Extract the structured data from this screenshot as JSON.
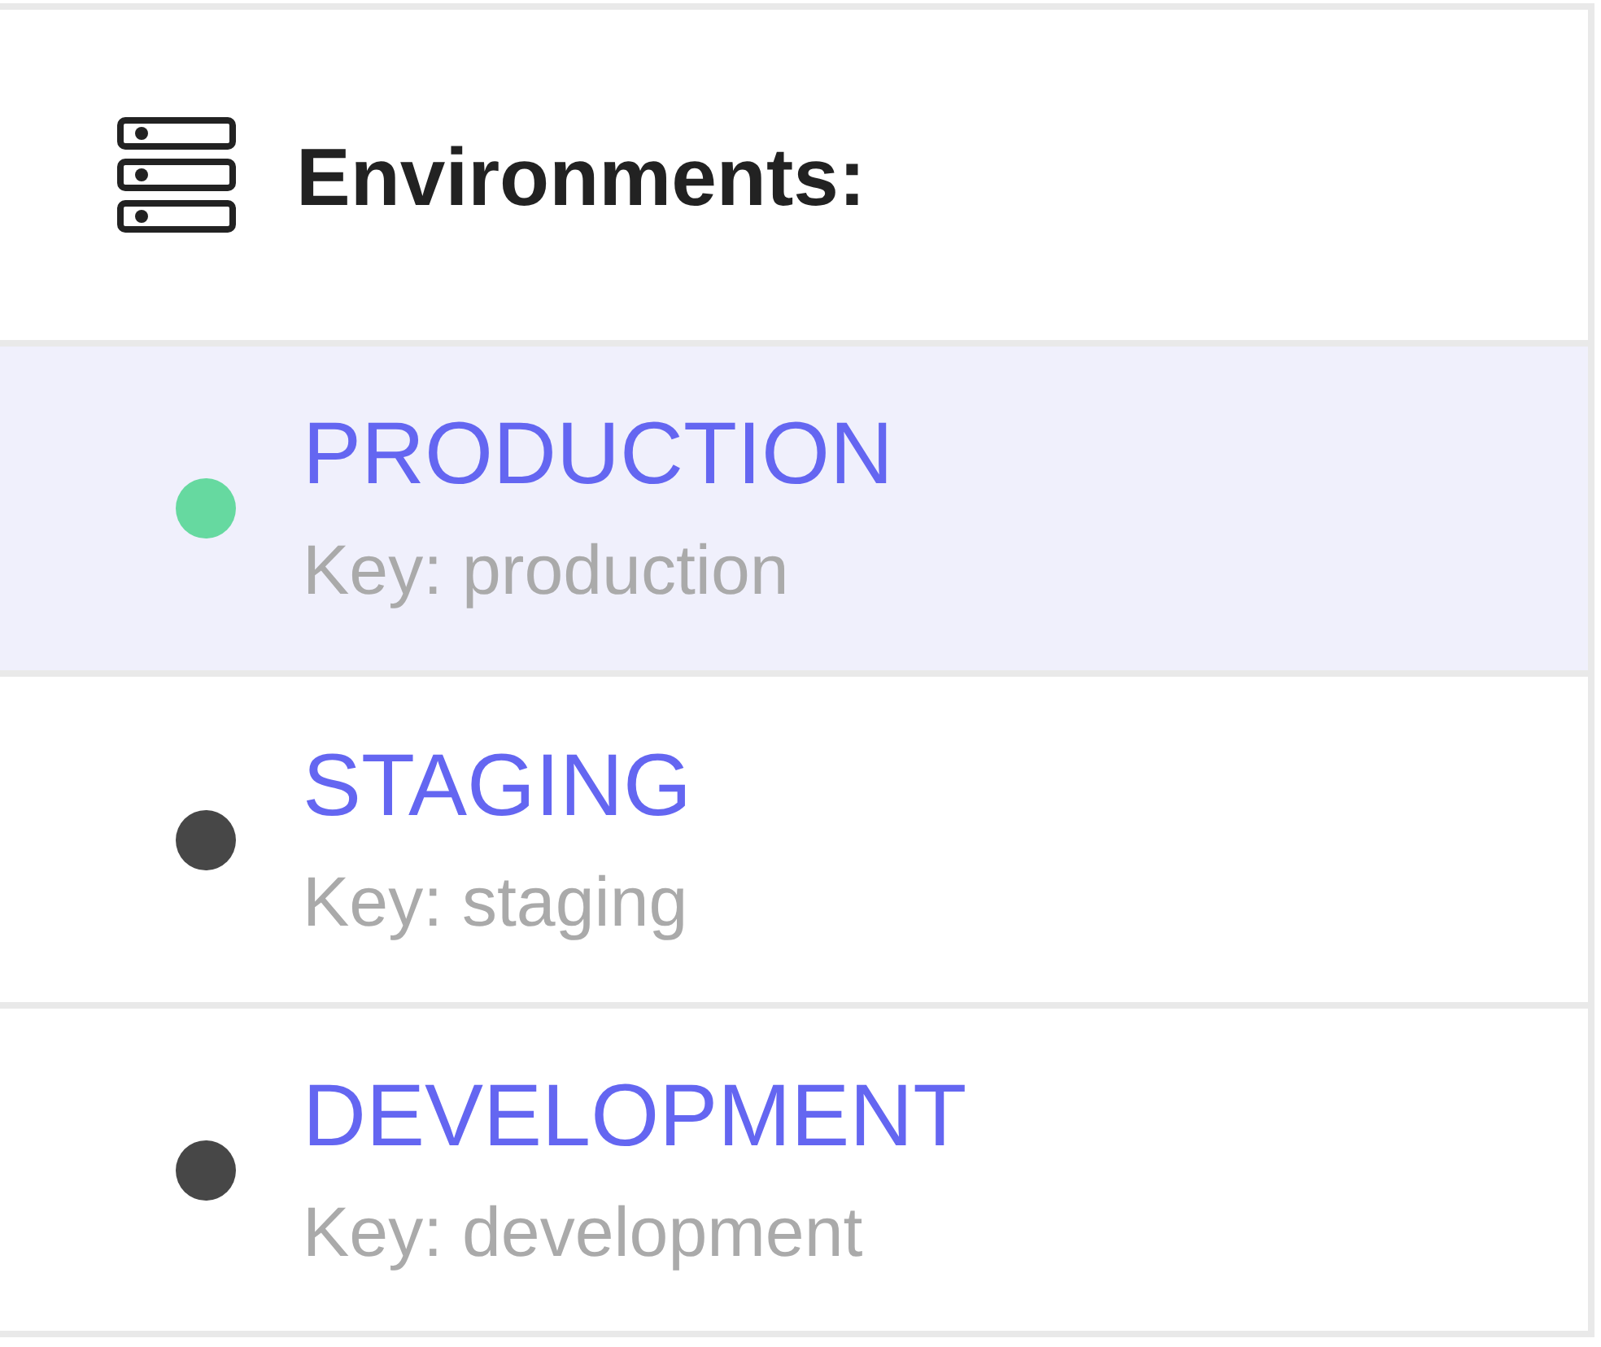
{
  "header": {
    "title": "Environments:"
  },
  "environments": [
    {
      "name": "PRODUCTION",
      "key": "Key: production",
      "selected": true,
      "color": "#66d9a0"
    },
    {
      "name": "STAGING",
      "key": "Key: staging",
      "selected": false,
      "color": "#474747"
    },
    {
      "name": "DEVELOPMENT",
      "key": "Key: development",
      "selected": false,
      "color": "#474747"
    }
  ]
}
